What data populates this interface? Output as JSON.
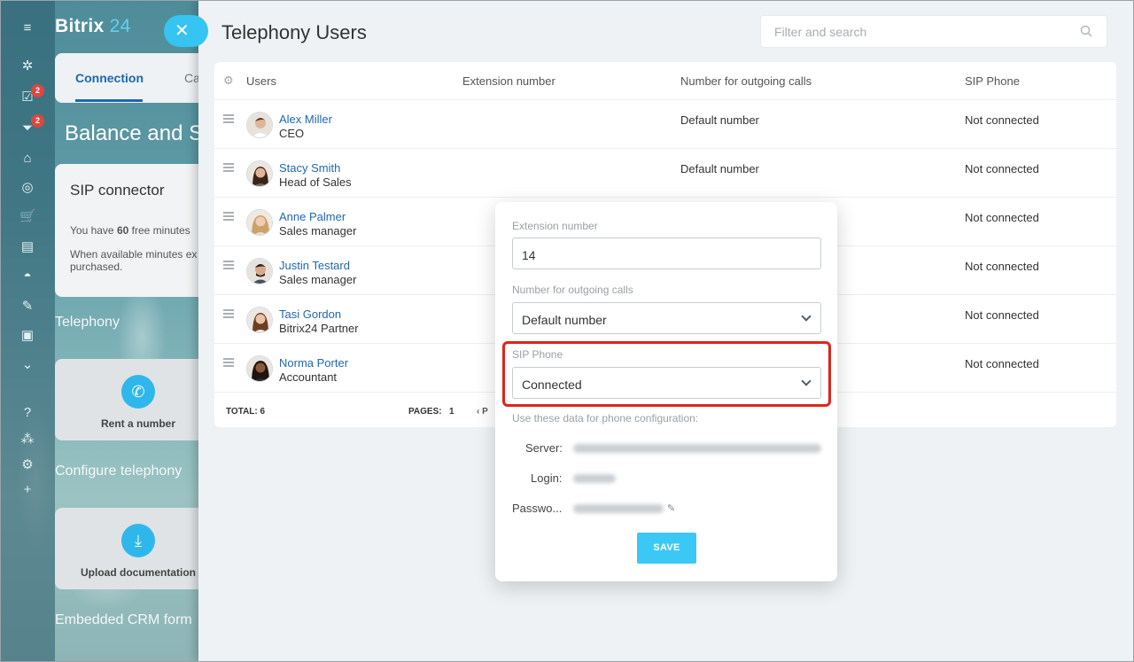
{
  "app": {
    "logo_main": "Bitrix",
    "logo_num": "24"
  },
  "left_rail": {
    "badges": [
      "2",
      "2"
    ]
  },
  "background_page": {
    "tabs": [
      "Connection",
      "Ca"
    ],
    "heading": "Balance and St",
    "sip_card": {
      "title": "SIP connector",
      "line1_pre": "You have ",
      "line1_num": "60",
      "line1_post": " free minutes",
      "line2": "When available minutes ex module is purchased."
    },
    "sections": [
      "Telephony",
      "Configure telephony",
      "Embedded CRM form"
    ],
    "tiles": [
      "Rent a number",
      "Upload documentation"
    ]
  },
  "slider": {
    "title": "Telephony Users",
    "search_placeholder": "Filter and search",
    "columns": [
      "Users",
      "Extension number",
      "Number for outgoing calls",
      "SIP Phone"
    ],
    "rows": [
      {
        "name": "Alex Miller",
        "position": "CEO",
        "outgoing": "Default number",
        "sip": "Not connected"
      },
      {
        "name": "Stacy Smith",
        "position": "Head of Sales",
        "outgoing": "Default number",
        "sip": "Not connected"
      },
      {
        "name": "Anne Palmer",
        "position": "Sales manager",
        "outgoing": "",
        "sip": "Not connected"
      },
      {
        "name": "Justin Testard",
        "position": "Sales manager",
        "outgoing": "",
        "sip": "Not connected"
      },
      {
        "name": "Tasi Gordon",
        "position": "Bitrix24 Partner",
        "outgoing": "",
        "sip": "Not connected"
      },
      {
        "name": "Norma Porter",
        "position": "Accountant",
        "outgoing": "",
        "sip": "Not connected"
      }
    ],
    "footer": {
      "total_label": "TOTAL:",
      "total": "6",
      "pages_label": "PAGES:",
      "pages": "1",
      "prev": "‹ P"
    }
  },
  "popup": {
    "extension_label": "Extension number",
    "extension_value": "14",
    "outgoing_label": "Number for outgoing calls",
    "outgoing_value": "Default number",
    "sip_label": "SIP Phone",
    "sip_value": "Connected",
    "hint": "Use these data for phone configuration:",
    "server_label": "Server:",
    "login_label": "Login:",
    "password_label": "Passwo...",
    "save_label": "SAVE"
  },
  "colors": {
    "accent": "#3bc8f5",
    "link": "#2067b0",
    "highlight": "#e0241b",
    "badge": "#e0463d"
  }
}
